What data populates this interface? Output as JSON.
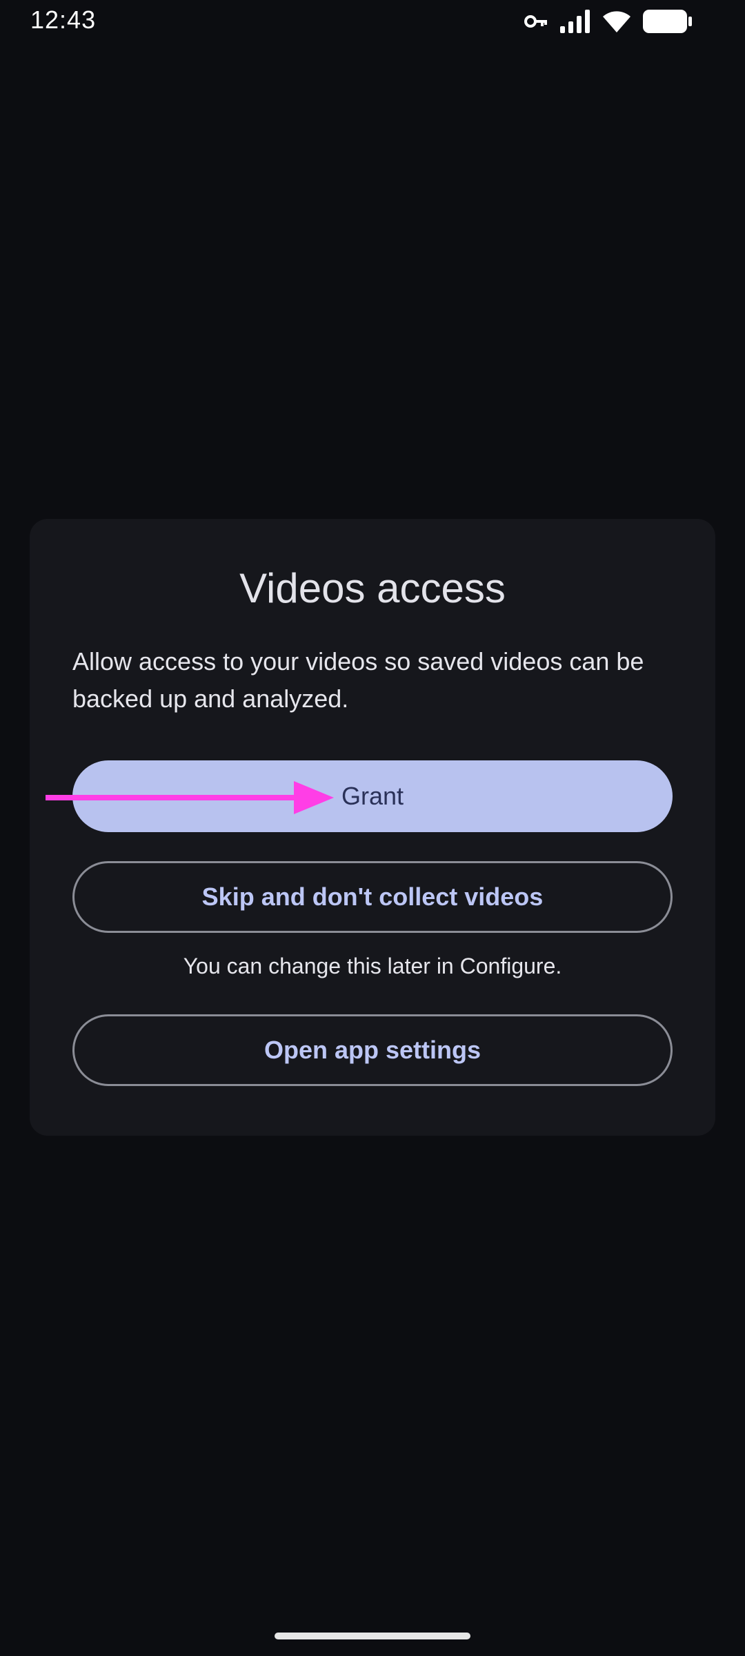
{
  "status_bar": {
    "time": "12:43",
    "icons": [
      "vpn-key-icon",
      "signal-icon",
      "wifi-icon",
      "battery-icon"
    ]
  },
  "dialog": {
    "title": "Videos access",
    "body": "Allow access to your videos so saved videos can be backed up and analyzed.",
    "grant_label": "Grant",
    "skip_label": "Skip and don't collect videos",
    "hint": "You can change this later in Configure.",
    "settings_label": "Open app settings"
  },
  "colors": {
    "background": "#0c0d11",
    "card": "#16171c",
    "primary_button": "#b8c2ef",
    "outline_text": "#bcc6f5",
    "annotation_arrow": "#ff3ee6"
  }
}
